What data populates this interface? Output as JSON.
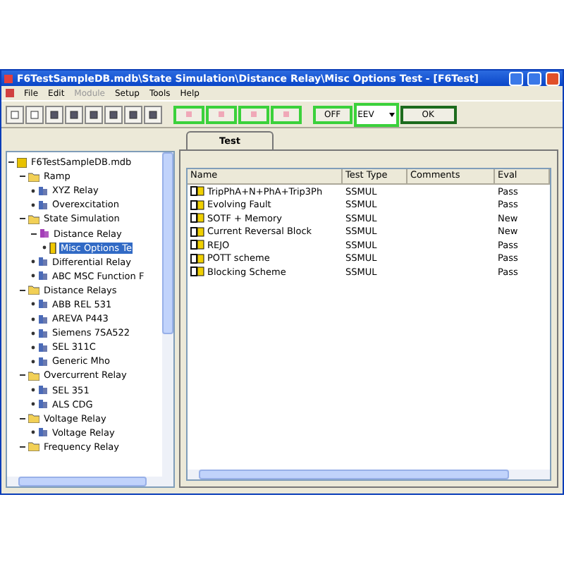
{
  "window": {
    "title": "F6TestSampleDB.mdb\\State Simulation\\Distance Relay\\Misc Options Test - [F6Test]"
  },
  "menu": [
    {
      "label": "File",
      "disabled": false
    },
    {
      "label": "Edit",
      "disabled": false
    },
    {
      "label": "Module",
      "disabled": true
    },
    {
      "label": "Setup",
      "disabled": false
    },
    {
      "label": "Tools",
      "disabled": false
    },
    {
      "label": "Help",
      "disabled": false
    }
  ],
  "toolbar": {
    "off_button": "OFF",
    "mode_select": "EEV",
    "ok_button": "OK"
  },
  "tree": [
    {
      "label": "F6TestSampleDB.mdb",
      "kind": "root",
      "expanded": true,
      "selected": false,
      "children": [
        {
          "label": "Ramp",
          "kind": "folder",
          "expanded": true,
          "selected": false,
          "children": [
            {
              "label": "XYZ Relay",
              "kind": "relay",
              "selected": false
            },
            {
              "label": "Overexcitation",
              "kind": "relay",
              "selected": false
            }
          ]
        },
        {
          "label": "State Simulation",
          "kind": "folder",
          "expanded": true,
          "selected": false,
          "children": [
            {
              "label": "Distance Relay",
              "kind": "relay-open",
              "expanded": true,
              "selected": false,
              "children": [
                {
                  "label": "Misc Options Te",
                  "kind": "test",
                  "selected": true
                }
              ]
            },
            {
              "label": "Differential Relay",
              "kind": "relay",
              "selected": false
            },
            {
              "label": "ABC MSC Function F",
              "kind": "relay",
              "selected": false
            }
          ]
        },
        {
          "label": "Distance Relays",
          "kind": "folder",
          "expanded": true,
          "selected": false,
          "children": [
            {
              "label": "ABB REL 531",
              "kind": "relay",
              "selected": false
            },
            {
              "label": "AREVA P443",
              "kind": "relay",
              "selected": false
            },
            {
              "label": "Siemens 7SA522",
              "kind": "relay",
              "selected": false
            },
            {
              "label": "SEL 311C",
              "kind": "relay",
              "selected": false
            },
            {
              "label": "Generic Mho",
              "kind": "relay",
              "selected": false
            }
          ]
        },
        {
          "label": "Overcurrent Relay",
          "kind": "folder",
          "expanded": true,
          "selected": false,
          "children": [
            {
              "label": "SEL 351",
              "kind": "relay",
              "selected": false
            },
            {
              "label": "ALS CDG",
              "kind": "relay",
              "selected": false
            }
          ]
        },
        {
          "label": "Voltage Relay",
          "kind": "folder",
          "expanded": true,
          "selected": false,
          "children": [
            {
              "label": "Voltage Relay",
              "kind": "relay",
              "selected": false
            }
          ]
        },
        {
          "label": "Frequency Relay",
          "kind": "folder",
          "expanded": true,
          "selected": false
        }
      ]
    }
  ],
  "tabs": [
    {
      "label": "Test",
      "selected": true
    }
  ],
  "table": {
    "columns": [
      "Name",
      "Test Type",
      "Comments",
      "Eval"
    ],
    "rows": [
      {
        "name": "TripPhA+N+PhA+Trip3Ph",
        "type": "SSMUL",
        "eval": "Pass"
      },
      {
        "name": "Evolving Fault",
        "type": "SSMUL",
        "eval": "Pass"
      },
      {
        "name": "SOTF + Memory",
        "type": "SSMUL",
        "eval": "New"
      },
      {
        "name": "Current Reversal Block",
        "type": "SSMUL",
        "eval": "New"
      },
      {
        "name": "REJO",
        "type": "SSMUL",
        "eval": "Pass"
      },
      {
        "name": "POTT scheme",
        "type": "SSMUL",
        "eval": "Pass"
      },
      {
        "name": "Blocking Scheme",
        "type": "SSMUL",
        "eval": "Pass"
      }
    ]
  }
}
